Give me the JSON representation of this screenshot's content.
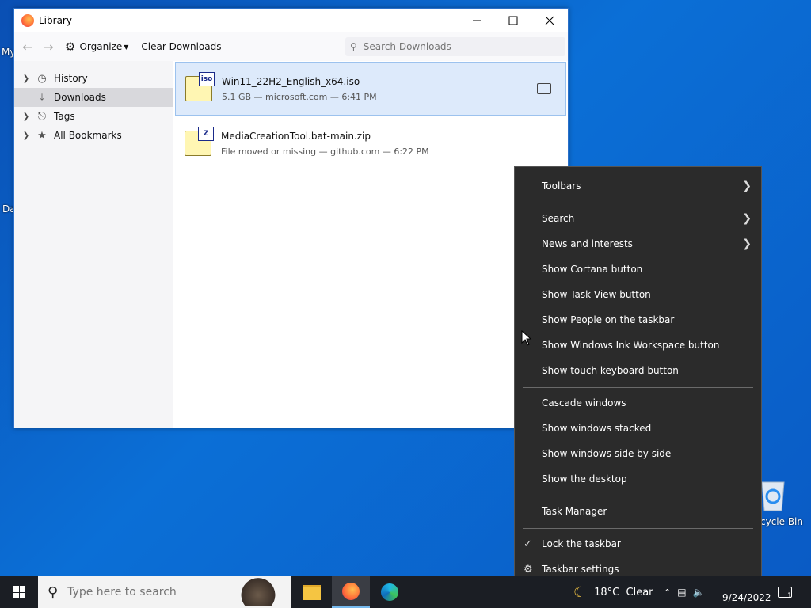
{
  "desktop": {
    "icon_text_1": "My",
    "icon_text_2": "Da",
    "recycle_label": "cycle Bin"
  },
  "library": {
    "title": "Library",
    "organize_label": "Organize",
    "clear_label": "Clear Downloads",
    "search_placeholder": "Search Downloads",
    "sidebar": [
      {
        "label": "History"
      },
      {
        "label": "Downloads"
      },
      {
        "label": "Tags"
      },
      {
        "label": "All Bookmarks"
      }
    ],
    "downloads": [
      {
        "name": "Win11_22H2_English_x64.iso",
        "meta": "5.1 GB — microsoft.com — 6:41 PM",
        "badge": "iso"
      },
      {
        "name": "MediaCreationTool.bat-main.zip",
        "meta": "File moved or missing — github.com — 6:22 PM",
        "badge": "Z"
      }
    ]
  },
  "context_menu": {
    "items": [
      {
        "label": "Toolbars"
      },
      {
        "label": "Search"
      },
      {
        "label": "News and interests"
      },
      {
        "label": "Show Cortana button"
      },
      {
        "label": "Show Task View button"
      },
      {
        "label": "Show People on the taskbar"
      },
      {
        "label": "Show Windows Ink Workspace button"
      },
      {
        "label": "Show touch keyboard button"
      },
      {
        "label": "Cascade windows"
      },
      {
        "label": "Show windows stacked"
      },
      {
        "label": "Show windows side by side"
      },
      {
        "label": "Show the desktop"
      },
      {
        "label": "Task Manager"
      },
      {
        "label": "Lock the taskbar"
      },
      {
        "label": "Taskbar settings"
      }
    ]
  },
  "taskbar": {
    "search_placeholder": "Type here to search",
    "weather": "18°C  Clear",
    "date": "9/24/2022",
    "notification_count": "1"
  }
}
